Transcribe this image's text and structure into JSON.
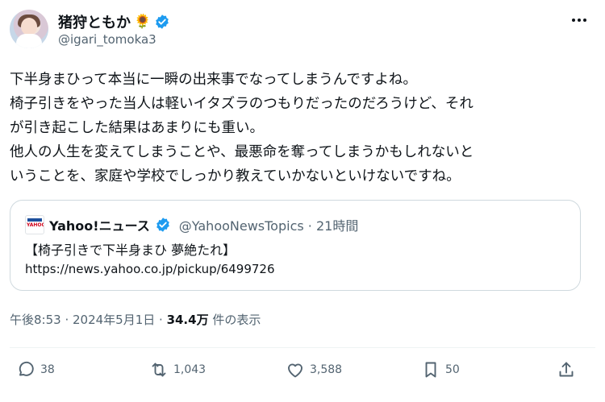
{
  "author": {
    "display_name": "猪狩ともか",
    "emoji": "🌻",
    "handle": "@igari_tomoka3"
  },
  "tweet_lines": [
    "下半身まひって本当に一瞬の出来事でなってしまうんですよね。",
    "椅子引きをやった当人は軽いイタズラのつもりだったのだろうけど、それ",
    "が引き起こした結果はあまりにも重い。",
    "他人の人生を変えてしまうことや、最悪命を奪ってしまうかもしれないと",
    "いうことを、家庭や学校でしっかり教えていかないといけないですね。"
  ],
  "quoted": {
    "logo_text": "YAHOO!",
    "name": "Yahoo!ニュース",
    "handle_time": "@YahooNewsTopics · 21時間",
    "title": "【椅子引きで下半身まひ 夢絶たれ】",
    "url": "https://news.yahoo.co.jp/pickup/6499726"
  },
  "meta": {
    "timestamp": "午後8:53 · 2024年5月1日 · ",
    "views_count": "34.4万",
    "views_label": " 件の表示"
  },
  "actions": {
    "replies": "38",
    "retweets": "1,043",
    "likes": "3,588",
    "bookmarks": "50"
  },
  "colors": {
    "verified": "#1d9bf0",
    "muted": "#536471",
    "text": "#0f1419",
    "border": "#cfd9de"
  }
}
